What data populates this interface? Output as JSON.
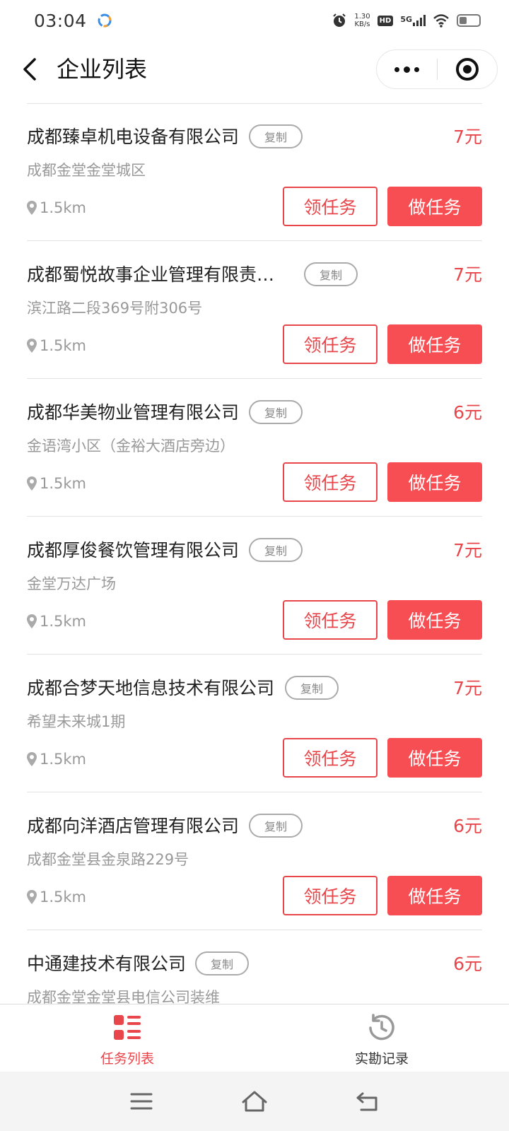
{
  "status_bar": {
    "time": "03:04",
    "net_speed_value": "1.30",
    "net_speed_unit": "KB/s",
    "hd": "HD",
    "network": "5G",
    "battery_level": 0.4
  },
  "nav": {
    "title": "企业列表"
  },
  "tasks": [
    {
      "company": "成都臻卓机电设备有限公司",
      "copy": "复制",
      "price": "7元",
      "address": "成都金堂金堂城区",
      "distance": "1.5km",
      "claim": "领任务",
      "do": "做任务"
    },
    {
      "company": "成都蜀悦故事企业管理有限责…",
      "copy": "复制",
      "price": "7元",
      "address": "滨江路二段369号附306号",
      "distance": "1.5km",
      "claim": "领任务",
      "do": "做任务"
    },
    {
      "company": "成都华美物业管理有限公司",
      "copy": "复制",
      "price": "6元",
      "address": "金语湾小区（金裕大酒店旁边）",
      "distance": "1.5km",
      "claim": "领任务",
      "do": "做任务"
    },
    {
      "company": "成都厚俊餐饮管理有限公司",
      "copy": "复制",
      "price": "7元",
      "address": "金堂万达广场",
      "distance": "1.5km",
      "claim": "领任务",
      "do": "做任务"
    },
    {
      "company": "成都合梦天地信息技术有限公司",
      "copy": "复制",
      "price": "7元",
      "address": "希望未来城1期",
      "distance": "1.5km",
      "claim": "领任务",
      "do": "做任务"
    },
    {
      "company": "成都向洋酒店管理有限公司",
      "copy": "复制",
      "price": "6元",
      "address": "成都金堂县金泉路229号",
      "distance": "1.5km",
      "claim": "领任务",
      "do": "做任务"
    },
    {
      "company": "中通建技术有限公司",
      "copy": "复制",
      "price": "6元",
      "address": "成都金堂金堂县电信公司装维",
      "distance": "",
      "claim": "",
      "do": ""
    }
  ],
  "tab_bar": {
    "tabs": [
      {
        "label": "任务列表",
        "icon": "list-icon",
        "active": true
      },
      {
        "label": "实勘记录",
        "icon": "history-icon",
        "active": false
      }
    ]
  },
  "colors": {
    "accent": "#e8464b",
    "button_fill": "#f74e53",
    "muted_text": "#999999"
  }
}
